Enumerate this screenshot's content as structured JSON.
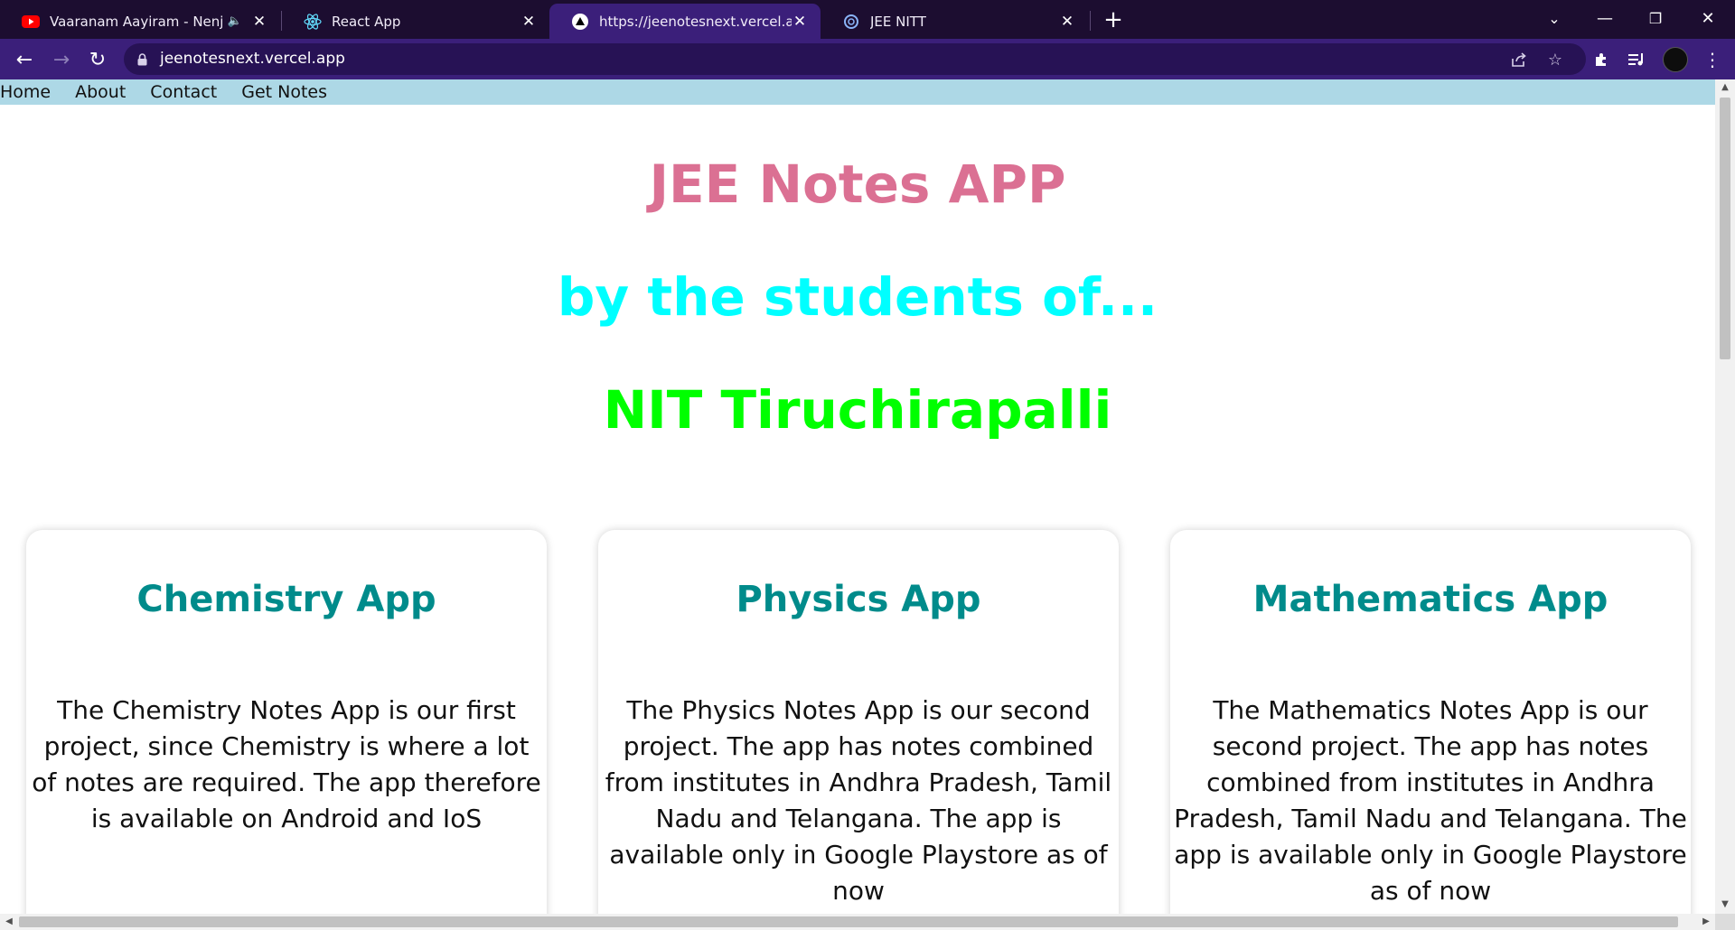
{
  "browser": {
    "tabs": [
      {
        "title": "Vaaranam Aayiram - Nenjukk",
        "favicon": "youtube-icon",
        "audio": true
      },
      {
        "title": "React App",
        "favicon": "react-icon",
        "audio": false
      },
      {
        "title": "https://jeenotesnext.vercel.app",
        "favicon": "vercel-icon",
        "audio": false,
        "active": true
      },
      {
        "title": "JEE NITT",
        "favicon": "loading-icon",
        "audio": false
      }
    ],
    "address": "jeenotesnext.vercel.app",
    "colors": {
      "frame": "#1c0d30",
      "toolbar": "#3b1f7a",
      "omnibox": "#271255"
    }
  },
  "site": {
    "nav": [
      "Home",
      "About",
      "Contact",
      "Get Notes"
    ],
    "headings": {
      "title": "JEE Notes APP",
      "subtitle": "by the students of...",
      "institute": "NIT Tiruchirapalli"
    },
    "cards": [
      {
        "title": "Chemistry App",
        "text": "The Chemistry Notes App is our first project, since Chemistry is where a lot of notes are required. The app therefore is available on Android and IoS"
      },
      {
        "title": "Physics App",
        "text": "The Physics Notes App is our second project. The app has notes combined from institutes in Andhra Pradesh, Tamil Nadu and Telangana. The app is available only in Google Playstore as of now"
      },
      {
        "title": "Mathematics App",
        "text": "The Mathematics Notes App is our second project. The app has notes combined from institutes in Andhra Pradesh, Tamil Nadu and Telangana. The app is available only in Google Playstore as of now"
      }
    ],
    "colors": {
      "nav_bg": "#add8e6",
      "title": "#db7093",
      "subtitle": "#00ffff",
      "institute": "#00ff00",
      "card_title": "#008b8b"
    }
  }
}
